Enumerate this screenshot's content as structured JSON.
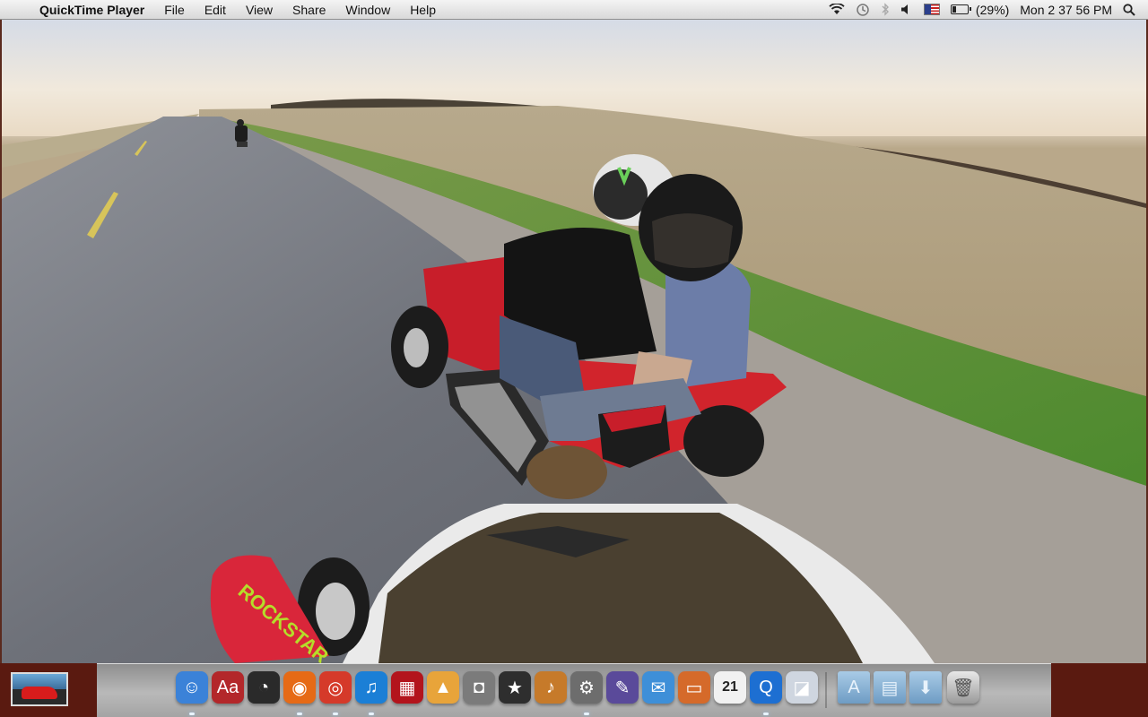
{
  "menubar": {
    "app_name": "QuickTime Player",
    "items": [
      "File",
      "Edit",
      "View",
      "Share",
      "Window",
      "Help"
    ],
    "battery_text": "(29%)",
    "clock": "Mon 2 37 56 PM"
  },
  "dock": {
    "apps": [
      {
        "name": "finder",
        "glyph": "☺",
        "color": "#3b82d8"
      },
      {
        "name": "dictionary",
        "glyph": "Aa",
        "color": "#b3272a"
      },
      {
        "name": "dashboard",
        "glyph": "◔",
        "color": "#2a2a2a"
      },
      {
        "name": "firefox",
        "glyph": "◉",
        "color": "#e66a16"
      },
      {
        "name": "chrome",
        "glyph": "◎",
        "color": "#d53a2a"
      },
      {
        "name": "itunes",
        "glyph": "♫",
        "color": "#1b7fd6"
      },
      {
        "name": "photo-booth",
        "glyph": "▦",
        "color": "#b3141c"
      },
      {
        "name": "iphoto",
        "glyph": "▲",
        "color": "#e8a43a"
      },
      {
        "name": "image-capture",
        "glyph": "◘",
        "color": "#7b7b7b"
      },
      {
        "name": "imovie",
        "glyph": "★",
        "color": "#2e2e2e"
      },
      {
        "name": "garageband",
        "glyph": "♪",
        "color": "#c67a2a"
      },
      {
        "name": "system-preferences",
        "glyph": "⚙",
        "color": "#6d6d6d"
      },
      {
        "name": "automator",
        "glyph": "✎",
        "color": "#5a4a9a"
      },
      {
        "name": "mail",
        "glyph": "✉",
        "color": "#3e8fd8"
      },
      {
        "name": "keynote",
        "glyph": "▭",
        "color": "#d56a2a"
      },
      {
        "name": "calendar",
        "glyph": "21",
        "color": "#f1f1f1"
      },
      {
        "name": "quicktime",
        "glyph": "Q",
        "color": "#1d6fd2"
      },
      {
        "name": "preview",
        "glyph": "◪",
        "color": "#cfd6e0"
      }
    ],
    "folders": [
      {
        "name": "applications-folder",
        "glyph": "A"
      },
      {
        "name": "documents-folder",
        "glyph": "▤"
      },
      {
        "name": "downloads-folder",
        "glyph": "⬇"
      }
    ]
  },
  "video": {
    "rider_shirt_text": "ROCKSTAR"
  }
}
